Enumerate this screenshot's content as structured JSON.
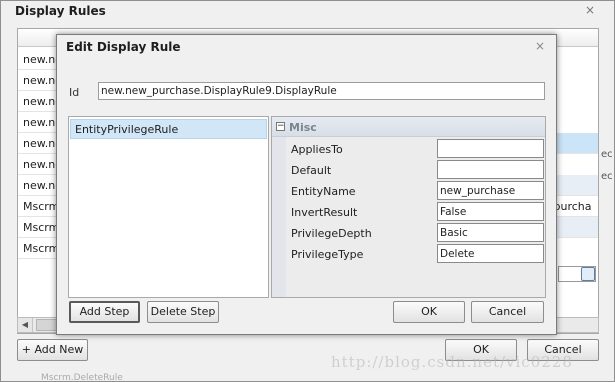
{
  "outer_dialog": {
    "title": "Display Rules",
    "close_glyph": "×",
    "rows": [
      "new.new",
      "new.new",
      "new.new",
      "new.new",
      "new.new",
      "new.new",
      "new.new",
      "Mscrm.",
      "Mscrm.",
      "Mscrm."
    ],
    "right_fragments": [
      "e",
      "_purcha",
      "ec",
      "ec"
    ],
    "add_new_label": "+ Add New",
    "ok_label": "OK",
    "cancel_label": "Cancel",
    "partial_footer_text": "Mscrm.DeleteRule",
    "watermark": "http://blog.csdn.net/vic0228"
  },
  "modal": {
    "title": "Edit Display Rule",
    "close_glyph": "×",
    "id_label": "Id",
    "id_value": "new.new_purchase.DisplayRule9.DisplayRule",
    "steps": [
      {
        "label": "EntityPrivilegeRule"
      }
    ],
    "add_step_label": "Add Step",
    "delete_step_label": "Delete Step",
    "ok_label": "OK",
    "cancel_label": "Cancel",
    "properties": {
      "category": "Misc",
      "collapse_glyph": "−",
      "items": [
        {
          "label": "AppliesTo",
          "value": ""
        },
        {
          "label": "Default",
          "value": ""
        },
        {
          "label": "EntityName",
          "value": "new_purchase"
        },
        {
          "label": "InvertResult",
          "value": "False"
        },
        {
          "label": "PrivilegeDepth",
          "value": "Basic"
        },
        {
          "label": "PrivilegeType",
          "value": "Delete"
        }
      ]
    }
  }
}
